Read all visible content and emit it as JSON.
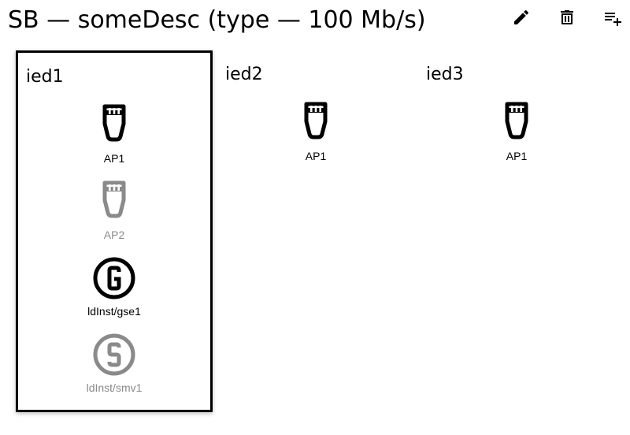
{
  "header": {
    "title": "SB — someDesc (type — 100 Mb/s)",
    "actions": [
      {
        "icon": "pencil-icon",
        "label": "edit"
      },
      {
        "icon": "trash-icon",
        "label": "delete"
      },
      {
        "icon": "playlist-add-icon",
        "label": "add"
      }
    ]
  },
  "ieds": [
    {
      "name": "ied1",
      "selected": true,
      "items": [
        {
          "type": "access-point",
          "label": "AP1",
          "state": "active"
        },
        {
          "type": "access-point",
          "label": "AP2",
          "state": "inactive"
        },
        {
          "type": "gse",
          "label": "ldInst/gse1",
          "state": "active"
        },
        {
          "type": "smv",
          "label": "ldInst/smv1",
          "state": "inactive"
        }
      ]
    },
    {
      "name": "ied2",
      "selected": false,
      "items": [
        {
          "type": "access-point",
          "label": "AP1",
          "state": "active"
        }
      ]
    },
    {
      "name": "ied3",
      "selected": false,
      "items": [
        {
          "type": "access-point",
          "label": "AP1",
          "state": "active"
        }
      ]
    }
  ],
  "colors": {
    "active": "#000000",
    "inactive": "#8a8a8a"
  }
}
